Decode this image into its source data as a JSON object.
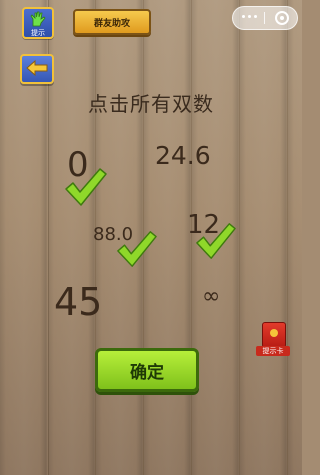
{
  "topbar": {
    "hint_label": "提示",
    "group_help_label": "群友助攻"
  },
  "question": "点击所有双数",
  "numbers": [
    {
      "text": "0",
      "checked": true
    },
    {
      "text": "24.6",
      "checked": false
    },
    {
      "text": "88.0",
      "checked": true
    },
    {
      "text": "12",
      "checked": true
    },
    {
      "text": "45",
      "checked": false
    },
    {
      "text": "∞",
      "checked": false
    }
  ],
  "tip_card_label": "提示卡",
  "confirm_label": "确定",
  "colors": {
    "check": "#8fd82a",
    "confirm_green": "#9bd82a",
    "button_blue": "#3d61c2",
    "button_orange": "#f0b035"
  }
}
